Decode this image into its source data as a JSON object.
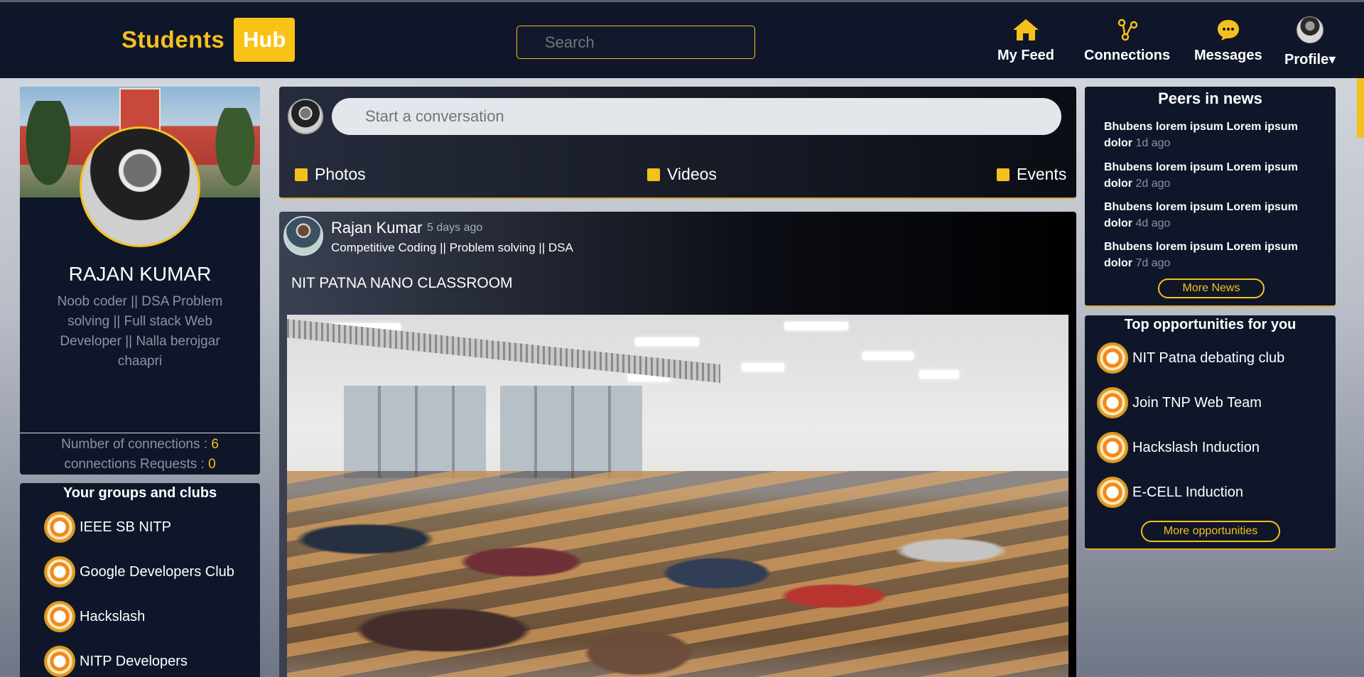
{
  "header": {
    "logo_word": "Students",
    "logo_badge": "Hub",
    "search_placeholder": "Search",
    "nav": [
      {
        "label": "My Feed",
        "icon": "home-icon"
      },
      {
        "label": "Connections",
        "icon": "connections-icon"
      },
      {
        "label": "Messages",
        "icon": "messages-icon"
      },
      {
        "label": "Profile",
        "icon": "profile-avatar"
      }
    ]
  },
  "profile": {
    "name": "RAJAN KUMAR",
    "bio": "Noob coder || DSA Problem solving || Full stack Web Developer || Nalla berojgar chaapri",
    "connections_label": "Number of connections :",
    "connections_value": "6",
    "requests_label": "connections Requests :",
    "requests_value": "0"
  },
  "groups": {
    "title": "Your groups and clubs",
    "items": [
      "IEEE SB NITP",
      "Google Developers Club",
      "Hackslash",
      "NITP Developers"
    ]
  },
  "composer": {
    "placeholder": "Start a conversation",
    "buttons": [
      "Photos",
      "Videos",
      "Events"
    ]
  },
  "post": {
    "author": "Rajan Kumar",
    "time": "5 days ago",
    "subtitle": "Competitive Coding || Problem solving || DSA",
    "title": "NIT PATNA NANO CLASSROOM"
  },
  "news": {
    "title": "Peers in news",
    "items": [
      {
        "text": "Bhubens lorem ipsum Lorem ipsum dolor",
        "ago": "1d ago"
      },
      {
        "text": "Bhubens lorem ipsum Lorem ipsum dolor",
        "ago": "2d ago"
      },
      {
        "text": "Bhubens lorem ipsum Lorem ipsum dolor",
        "ago": "4d ago"
      },
      {
        "text": "Bhubens lorem ipsum Lorem ipsum dolor",
        "ago": "7d ago"
      }
    ],
    "more_label": "More News"
  },
  "opportunities": {
    "title": "Top opportunities for you",
    "items": [
      "NIT Patna debating club",
      "Join TNP Web Team",
      "Hackslash Induction",
      "E-CELL Induction"
    ],
    "more_label": "More opportunities"
  },
  "colors": {
    "accent": "#f4c01e",
    "panel": "#0f1629"
  }
}
